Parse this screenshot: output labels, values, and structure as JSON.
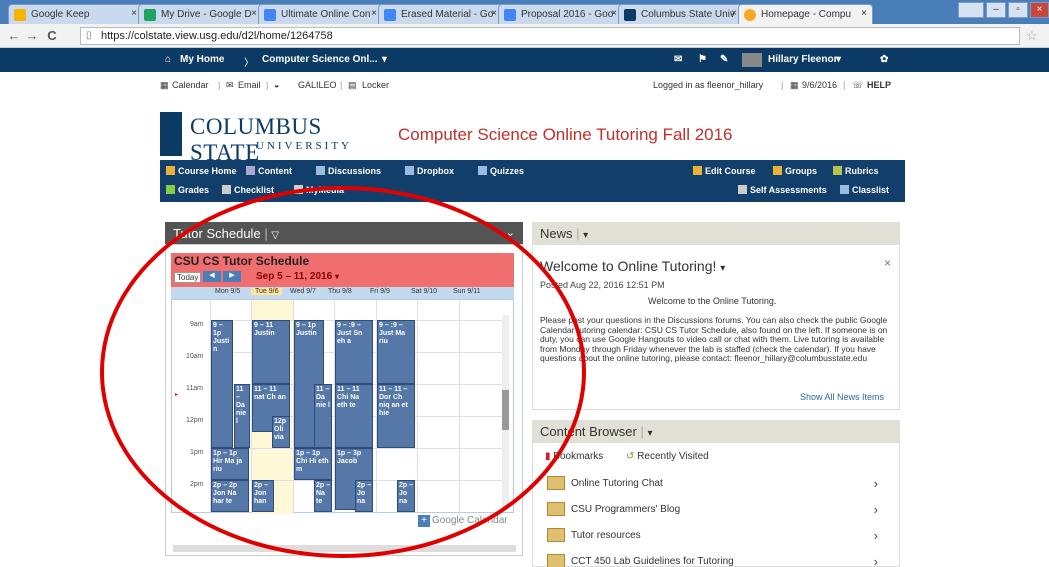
{
  "browser": {
    "tabs": [
      {
        "label": "Google Keep",
        "color": "#f4b400"
      },
      {
        "label": "My Drive - Google D",
        "color": "#1fa463"
      },
      {
        "label": "Ultimate Online Con",
        "color": "#4285f4"
      },
      {
        "label": "Erased Material - Go",
        "color": "#4285f4"
      },
      {
        "label": "Proposal 2016 - Goo",
        "color": "#4285f4"
      },
      {
        "label": "Columbus State Univ",
        "color": "#0b3b64"
      },
      {
        "label": "Homepage - Compu",
        "color": "#f9a825"
      }
    ],
    "url": "https://colstate.view.usg.edu/d2l/home/1264758"
  },
  "topnav": {
    "home": "My Home",
    "course": "Computer Science Onl...",
    "user": "Hillary Fleenor"
  },
  "utility": {
    "calendar": "Calendar",
    "email": "Email",
    "galileo": "GALILEO",
    "locker": "Locker",
    "logged_in": "Logged in as fleenor_hillary",
    "date": "9/6/2016",
    "help": "HELP"
  },
  "logo": {
    "line1": "COLUMBUS STATE",
    "line2": "UNIVERSITY"
  },
  "course_title": "Computer Science Online Tutoring Fall 2016",
  "coursenav": {
    "course_home": "Course Home",
    "content": "Content",
    "discussions": "Discussions",
    "dropbox": "Dropbox",
    "quizzes": "Quizzes",
    "edit_course": "Edit Course",
    "groups": "Groups",
    "rubrics": "Rubrics",
    "grades": "Grades",
    "checklist": "Checklist",
    "mymedia": "MyMedia",
    "self_assessments": "Self Assessments",
    "classlist": "Classlist"
  },
  "tutor_schedule": {
    "header": "Tutor Schedule",
    "cal_title": "CSU CS Tutor Schedule",
    "today": "Today",
    "range": "Sep 5 – 11, 2016",
    "days": [
      "Mon 9/5",
      "Tue 9/6",
      "Wed 9/7",
      "Thu 9/8",
      "Fri 9/9",
      "Sat 9/10",
      "Sun 9/11"
    ],
    "hours": [
      "9am",
      "10am",
      "11am",
      "12pm",
      "1pm",
      "2pm"
    ],
    "events": [
      {
        "t": "9 – 1p",
        "n": "Justi n"
      },
      {
        "t": "9 – 11",
        "n": "Justin"
      },
      {
        "t": "9 – 1p",
        "n": "Justin"
      },
      {
        "t": "9 – :9 –",
        "n": "Just Sn eh a"
      },
      {
        "t": "9 – :9 –",
        "n": "Just Ma riu"
      },
      {
        "t": "11 –",
        "n": "Da nie l"
      },
      {
        "t": "11 – 11",
        "n": "nat Ch an"
      },
      {
        "t": "12p",
        "n": "Oli via"
      },
      {
        "t": "11 –",
        "n": "Da nie l"
      },
      {
        "t": "11 – 11",
        "n": "Chi Na eth te"
      },
      {
        "t": "11 – 11 –",
        "n": "Dor Ch niq an et hie"
      },
      {
        "t": "1p – 1p",
        "n": "Hir Ma ja riu"
      },
      {
        "t": "1p – 1p",
        "n": "Chi Hi eth m"
      },
      {
        "t": "1p – 3p",
        "n": "Jacob"
      },
      {
        "t": "2p – 2p",
        "n": "Jon Na har te"
      },
      {
        "t": "2p –",
        "n": "Jon han"
      },
      {
        "t": "2p –",
        "n": "Na te"
      },
      {
        "t": "2p –",
        "n": "Jo na"
      },
      {
        "t": "2p –",
        "n": "Jo na"
      }
    ],
    "gcal": "Google Calendar"
  },
  "news": {
    "header": "News",
    "title": "Welcome to Online Tutoring!",
    "posted": "Posted Aug 22, 2016 12:51 PM",
    "welcome": "Welcome to the Online Tutoring.",
    "body": "Please post your questions in the Discussions forums. You can also check the public Google Calendar tutoring calendar: CSU CS Tutor Schedule, also found on the left. If someone is on duty, you can use Google Hangouts to video call or chat with them. Live tutoring is available from Monday through Friday whenever the lab is staffed (check the calendar). If you have questions about the online tutoring, please contact: fleenor_hillary@columbusstate.edu",
    "show_all": "Show All News Items"
  },
  "content_browser": {
    "header": "Content Browser",
    "bookmarks": "Bookmarks",
    "recent": "Recently Visited",
    "items": [
      "Online Tutoring Chat",
      "CSU Programmers' Blog",
      "Tutor resources",
      "CCT 450 Lab Guidelines for Tutoring"
    ]
  },
  "annotation": {
    "color": "#e10000"
  }
}
